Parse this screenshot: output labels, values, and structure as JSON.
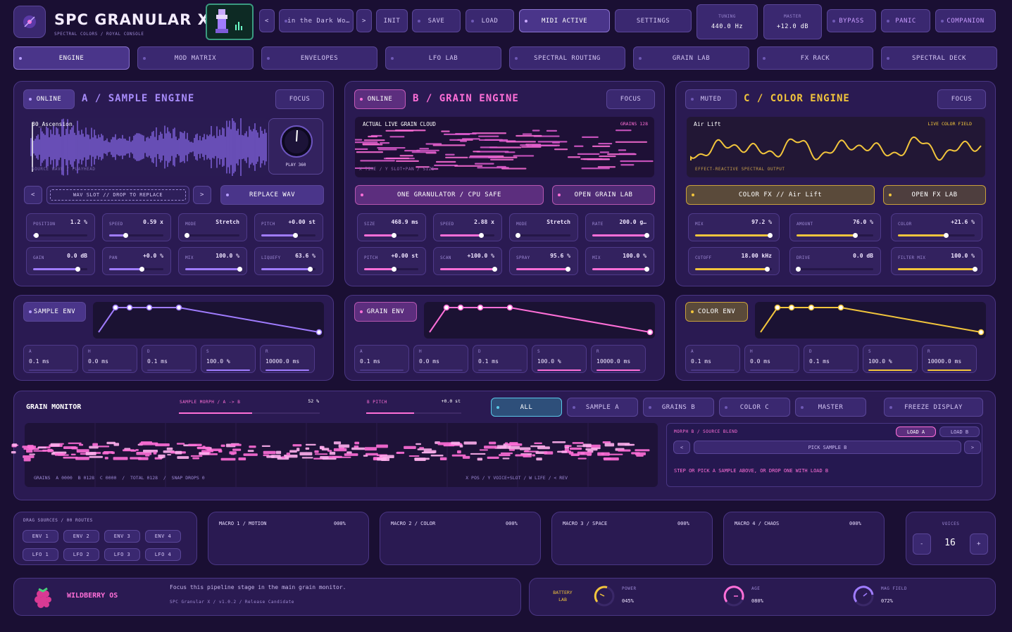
{
  "app": {
    "title": "SPC GRANULAR X",
    "subtitle": "SPECTRAL COLORS / ROYAL CONSOLE"
  },
  "header": {
    "preset_prev": "<",
    "preset_name": "in the Dark Wo…",
    "preset_next": ">",
    "init": "INIT",
    "save": "SAVE",
    "load": "LOAD",
    "midi": "MIDI ACTIVE",
    "settings": "SETTINGS",
    "tuning_label": "TUNING",
    "tuning_value": "440.0 Hz",
    "master_label": "MASTER",
    "master_value": "+12.0 dB",
    "bypass": "BYPASS",
    "panic": "PANIC",
    "companion": "COMPANION"
  },
  "tabs": [
    "ENGINE",
    "MOD MATRIX",
    "ENVELOPES",
    "LFO LAB",
    "SPECTRAL ROUTING",
    "GRAIN LAB",
    "FX RACK",
    "SPECTRAL DECK"
  ],
  "engine_a": {
    "status": "ONLINE",
    "title": "A / SAMPLE ENGINE",
    "focus": "FOCUS",
    "sample_name": "30_Ascension",
    "wave_caption": "SOURCE WAVE / PLAYHEAD",
    "knob_label": "PLAY 360",
    "prev": "<",
    "slot_text": "WAV SLOT // DROP TO REPLACE",
    "next": ">",
    "replace": "REPLACE WAV",
    "params": [
      {
        "label": "POSITION",
        "value": "1.2 %",
        "fill": 0.05
      },
      {
        "label": "SPEED",
        "value": "0.59 x",
        "fill": 0.3
      },
      {
        "label": "MODE",
        "value": "Stretch",
        "fill": 0.02
      },
      {
        "label": "PITCH",
        "value": "+0.00 st",
        "fill": 0.62
      },
      {
        "label": "GAIN",
        "value": "0.0 dB",
        "fill": 0.82
      },
      {
        "label": "PAN",
        "value": "+0.0 %",
        "fill": 0.6
      },
      {
        "label": "MIX",
        "value": "100.0 %",
        "fill": 1.0
      },
      {
        "label": "LIQUEFY",
        "value": "63.6 %",
        "fill": 0.9
      }
    ]
  },
  "engine_b": {
    "status": "ONLINE",
    "title": "B / GRAIN ENGINE",
    "focus": "FOCUS",
    "cloud_title": "ACTUAL LIVE GRAIN CLOUD",
    "grains": "GRAINS 128",
    "cloud_caption": "X TIME / Y SLOT+PAN / SIZE",
    "btn_granulator": "ONE GRANULATOR / CPU SAFE",
    "btn_lab": "OPEN GRAIN LAB",
    "params": [
      {
        "label": "SIZE",
        "value": "468.9 ms",
        "fill": 0.55
      },
      {
        "label": "SPEED",
        "value": "2.88 x",
        "fill": 0.75
      },
      {
        "label": "MODE",
        "value": "Stretch",
        "fill": 0.02
      },
      {
        "label": "RATE",
        "value": "200.0 g…",
        "fill": 1.0
      },
      {
        "label": "PITCH",
        "value": "+0.00 st",
        "fill": 0.55
      },
      {
        "label": "SCAN",
        "value": "+100.0 %",
        "fill": 1.0
      },
      {
        "label": "SPRAY",
        "value": "95.6 %",
        "fill": 0.95
      },
      {
        "label": "MIX",
        "value": "100.0 %",
        "fill": 1.0
      }
    ]
  },
  "engine_c": {
    "status": "MUTED",
    "title": "C / COLOR ENGINE",
    "focus": "FOCUS",
    "preset": "Air Lift",
    "field": "LIVE COLOR FIELD",
    "caption": "EFFECT-REACTIVE SPECTRAL OUTPUT",
    "btn_fx": "COLOR FX // Air Lift",
    "btn_lab": "OPEN FX LAB",
    "params": [
      {
        "label": "MIX",
        "value": "97.2 %",
        "fill": 0.97
      },
      {
        "label": "AMOUNT",
        "value": "76.0 %",
        "fill": 0.76
      },
      {
        "label": "COLOR",
        "value": "+21.6 %",
        "fill": 0.62
      },
      {
        "label": "CUTOFF",
        "value": "18.00 kHz",
        "fill": 0.94
      },
      {
        "label": "DRIVE",
        "value": "0.0 dB",
        "fill": 0.02
      },
      {
        "label": "FILTER MIX",
        "value": "100.0 %",
        "fill": 1.0
      }
    ]
  },
  "env_a": {
    "title": "SAMPLE ENV",
    "items": [
      {
        "label": "A",
        "value": "0.1 ms"
      },
      {
        "label": "H",
        "value": "0.0 ms"
      },
      {
        "label": "D",
        "value": "0.1 ms"
      },
      {
        "label": "S",
        "value": "100.0 %"
      },
      {
        "label": "R",
        "value": "10000.0 ms"
      }
    ]
  },
  "env_b": {
    "title": "GRAIN ENV",
    "items": [
      {
        "label": "A",
        "value": "0.1 ms"
      },
      {
        "label": "H",
        "value": "0.0 ms"
      },
      {
        "label": "D",
        "value": "0.1 ms"
      },
      {
        "label": "S",
        "value": "100.0 %"
      },
      {
        "label": "R",
        "value": "10000.0 ms"
      }
    ]
  },
  "env_c": {
    "title": "COLOR ENV",
    "items": [
      {
        "label": "A",
        "value": "0.1 ms"
      },
      {
        "label": "H",
        "value": "0.0 ms"
      },
      {
        "label": "D",
        "value": "0.1 ms"
      },
      {
        "label": "S",
        "value": "100.0 %"
      },
      {
        "label": "R",
        "value": "10000.0 ms"
      }
    ]
  },
  "monitor": {
    "title": "GRAIN MONITOR",
    "morph_label": "SAMPLE MORPH / A -> B",
    "morph_value": "52 %",
    "morph_fill": 0.52,
    "pitch_label": "B PITCH",
    "pitch_value": "+0.0 st",
    "pitch_fill": 0.5,
    "filters": [
      "ALL",
      "SAMPLE A",
      "GRAINS B",
      "COLOR C",
      "MASTER"
    ],
    "freeze": "FREEZE DISPLAY",
    "stats": "GRAINS  A 0000  B 0128  C 0000  /  TOTAL 0128  /  SNAP DROPS 0",
    "legend": "X POS / Y VOICE+SLOT / W LIFE / < REV",
    "morph_title": "MORPH B / SOURCE BLEND",
    "load_a": "LOAD A",
    "load_b": "LOAD B",
    "pick_prev": "<",
    "pick": "PICK SAMPLE B",
    "pick_next": ">",
    "hint": "STEP OR PICK A SAMPLE ABOVE, OR DROP ONE WITH LOAD B"
  },
  "drag": {
    "title": "DRAG SOURCES / 00 ROUTES",
    "sources": [
      "ENV 1",
      "ENV 2",
      "ENV 3",
      "ENV 4",
      "LFO 1",
      "LFO 2",
      "LFO 3",
      "LFO 4"
    ]
  },
  "macros": [
    {
      "name": "MACRO 1 / MOTION",
      "value": "000%"
    },
    {
      "name": "MACRO 2 / COLOR",
      "value": "000%"
    },
    {
      "name": "MACRO 3 / SPACE",
      "value": "000%"
    },
    {
      "name": "MACRO 4 / CHAOS",
      "value": "000%"
    }
  ],
  "voices": {
    "label": "VOICES",
    "value": "16",
    "minus": "-",
    "plus": "+"
  },
  "footer": {
    "brand": "WILDBERRY OS",
    "hint": "Focus this pipeline stage in the main grain monitor.",
    "version": "SPC Granular X / v1.0.2 / Release Candidate",
    "battery_title": "BATTERY LAB",
    "power_label": "POWER",
    "power_value": "045%",
    "age_label": "AGE",
    "age_value": "080%",
    "mag_label": "MAG FIELD",
    "mag_value": "072%"
  },
  "colors": {
    "bg": "#1a0f33",
    "panel": "#2a1a52",
    "violet": "#a07cff",
    "pink": "#ff6fd8",
    "gold": "#f2c53c"
  }
}
